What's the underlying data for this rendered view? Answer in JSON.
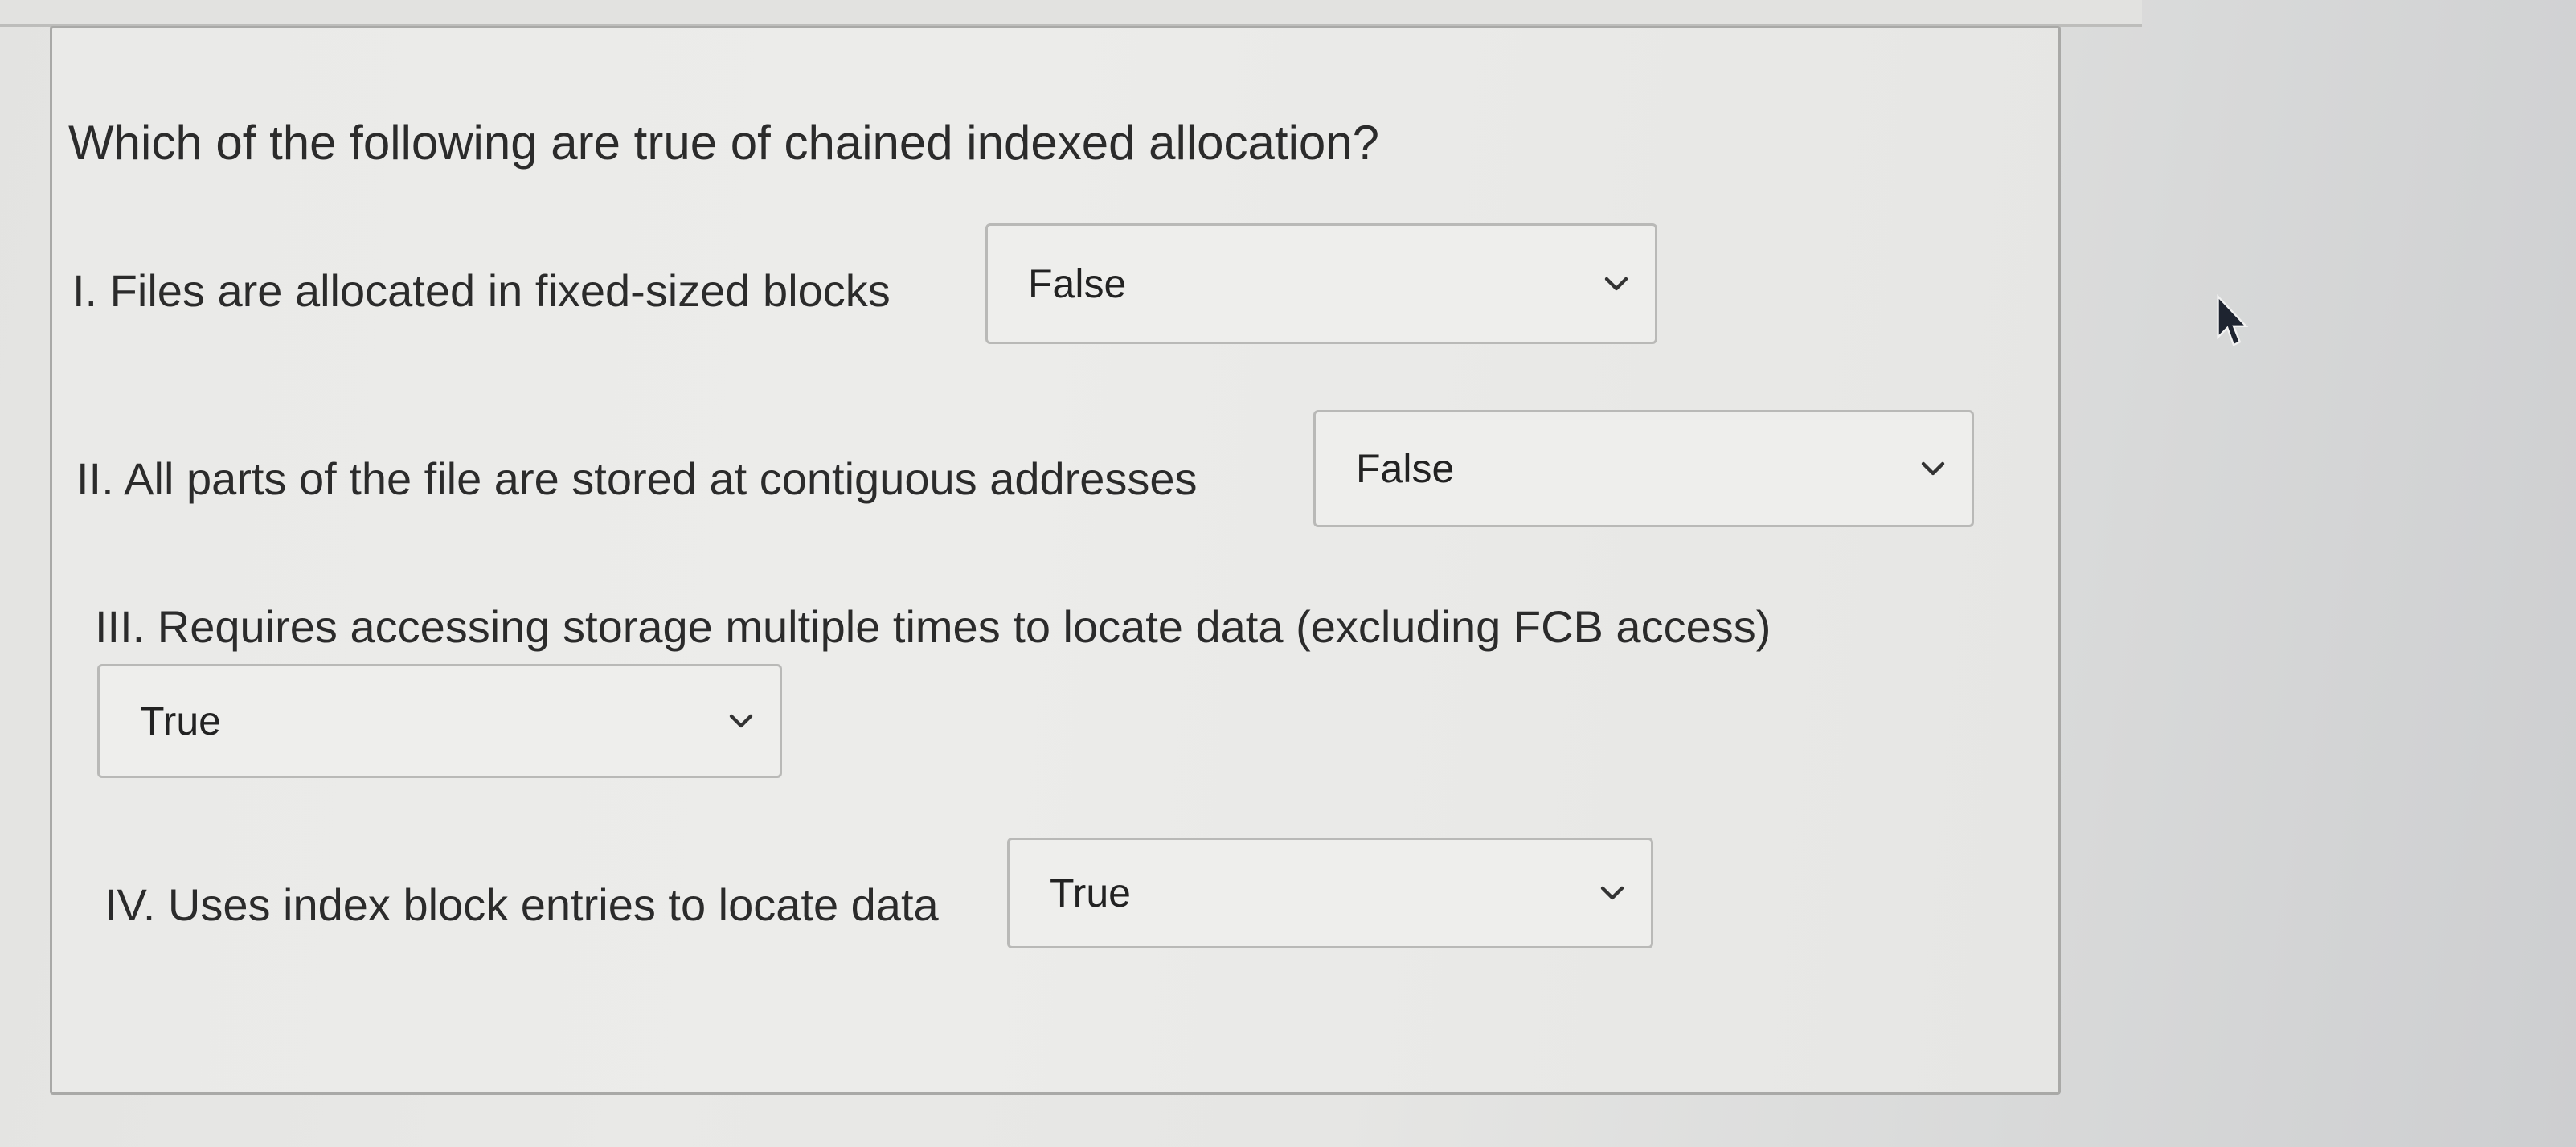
{
  "question": {
    "prompt": "Which of the following are true of chained indexed allocation?"
  },
  "items": [
    {
      "label": "I. Files are allocated in fixed-sized blocks",
      "selected": "False"
    },
    {
      "label": "II. All parts of the file are stored at contiguous addresses",
      "selected": "False"
    },
    {
      "label": "III. Requires accessing storage multiple times to locate data (excluding FCB access)",
      "selected": "True"
    },
    {
      "label": "IV. Uses index block entries to locate data",
      "selected": "True"
    }
  ],
  "icons": {
    "dropdown": "chevron-down-icon",
    "pointer": "mouse-cursor-icon"
  },
  "colors": {
    "text": "#2b2b2b",
    "border": "#b9b9b7",
    "background": "#e8e8e6"
  }
}
